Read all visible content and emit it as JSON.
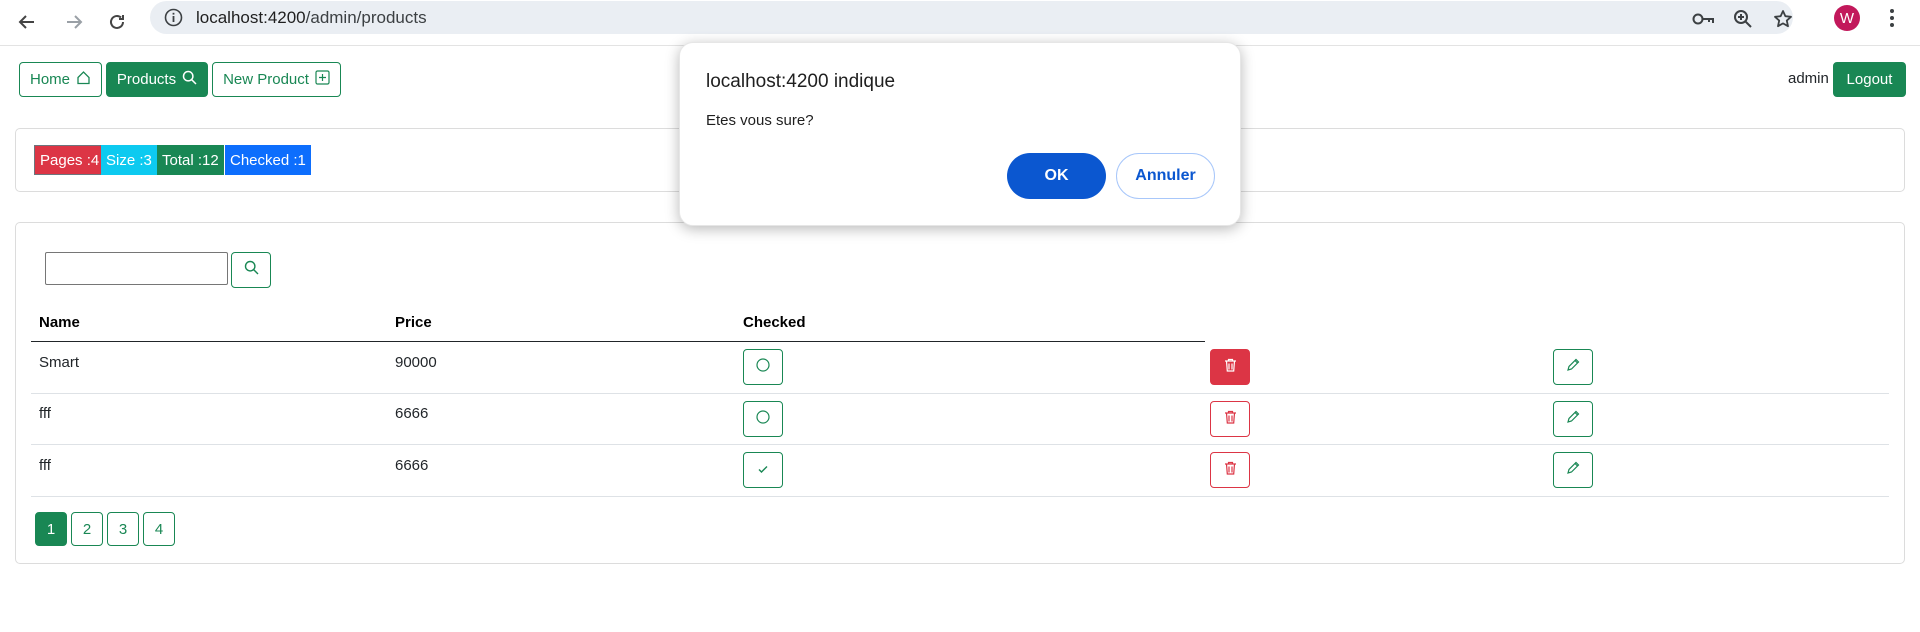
{
  "browser": {
    "url_host": "localhost:4200",
    "url_path": "/admin/products",
    "profile_initial": "W",
    "icons": [
      "back-arrow-icon",
      "forward-arrow-icon",
      "reload-icon",
      "site-info-icon",
      "password-key-icon",
      "zoom-icon",
      "bookmark-star-icon",
      "menu-kebab-icon"
    ]
  },
  "navbar": {
    "home_label": "Home",
    "products_label": "Products",
    "new_product_label": "New Product",
    "username": "admin",
    "logout_label": "Logout"
  },
  "stats": {
    "pages": "Pages :4",
    "size": "Size :3",
    "total": "Total :12",
    "checked": "Checked :1",
    "colors": {
      "pages": "#dc3545",
      "size": "#0dcaf0",
      "total": "#198754",
      "checked": "#0d6efd"
    }
  },
  "search": {
    "value": ""
  },
  "table": {
    "headers": [
      "Name",
      "Price",
      "Checked"
    ],
    "rows": [
      {
        "name": "Smart",
        "price": "90000",
        "checked": false,
        "delete_style": "filled"
      },
      {
        "name": "fff",
        "price": "6666",
        "checked": false,
        "delete_style": "outline"
      },
      {
        "name": "fff",
        "price": "6666",
        "checked": true,
        "delete_style": "outline"
      }
    ]
  },
  "pagination": {
    "pages": [
      "1",
      "2",
      "3",
      "4"
    ],
    "current": "1"
  },
  "dialog": {
    "title": "localhost:4200 indique",
    "message": "Etes vous sure?",
    "ok_label": "OK",
    "cancel_label": "Annuler"
  },
  "theme": {
    "primary": "#198754",
    "danger": "#dc3545",
    "dialog_button": "#0b57d0"
  }
}
